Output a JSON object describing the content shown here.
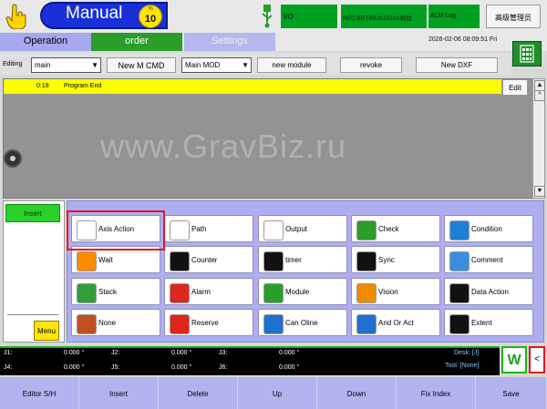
{
  "header": {
    "mode": "Manual",
    "speed_percent_label": "%",
    "speed_value": "10",
    "io_label": "I/O",
    "rec_label": "REC:BRTIRUS1510A机位",
    "alarm_log_label": "ALM Log",
    "user_label": "高级管理员"
  },
  "tabs": [
    {
      "label": "Operation"
    },
    {
      "label": "order"
    },
    {
      "label": "Settings"
    }
  ],
  "datetime": "2026-02-06  08:09:51 Fri",
  "editbar": {
    "editing_label": "Editing",
    "program_value": "main",
    "new_cmd_label": "New M CMD",
    "module_value": "Main MOD",
    "new_module_label": "new module",
    "revoke_label": "revoke",
    "new_dxf_label": "New DXF"
  },
  "program": {
    "line_number": "0:18",
    "line_text": "Program End",
    "edit_label": "Edit",
    "watermark": "www.GravBiz.ru"
  },
  "left_panel": {
    "insert_label": "Insert",
    "menu_label": "Menu"
  },
  "actions": [
    {
      "label": "Axis Action",
      "icon": "axis-action-icon",
      "color": "#ffffff"
    },
    {
      "label": "Path",
      "icon": "path-icon",
      "color": "#ffffff"
    },
    {
      "label": "Output",
      "icon": "output-icon",
      "color": "#ffffff"
    },
    {
      "label": "Check",
      "icon": "check-shield-icon",
      "color": "#2a9d2a"
    },
    {
      "label": "Condition",
      "icon": "condition-icon",
      "color": "#1e7fd9"
    },
    {
      "label": "Wait",
      "icon": "wait-pause-icon",
      "color": "#ff8a00"
    },
    {
      "label": "Counter",
      "icon": "counter-icon",
      "color": "#111111"
    },
    {
      "label": "timer",
      "icon": "timer-icon",
      "color": "#111111"
    },
    {
      "label": "Sync",
      "icon": "sync-arrows-icon",
      "color": "#111111"
    },
    {
      "label": "Comment",
      "icon": "comment-bubble-icon",
      "color": "#3a8ee0"
    },
    {
      "label": "Stack",
      "icon": "stack-cubes-icon",
      "color": "#2f9e3a"
    },
    {
      "label": "Alarm",
      "icon": "alarm-hand-icon",
      "color": "#e0251b"
    },
    {
      "label": "Module",
      "icon": "module-icon",
      "color": "#2a9d2a"
    },
    {
      "label": "Vision",
      "icon": "vision-camera-icon",
      "color": "#f08a00"
    },
    {
      "label": "Data Action",
      "icon": "data-action-icon",
      "color": "#111111"
    },
    {
      "label": "None",
      "icon": "none-brush-icon",
      "color": "#c05020"
    },
    {
      "label": "Reserve",
      "icon": "reserve-icon",
      "color": "#e0251b"
    },
    {
      "label": "Can Oline",
      "icon": "can-online-icon",
      "color": "#2070d0"
    },
    {
      "label": "And Or Act",
      "icon": "and-or-icon",
      "color": "#2070d0"
    },
    {
      "label": "Extent",
      "icon": "extent-icon",
      "color": "#111111"
    }
  ],
  "status": {
    "joints": [
      {
        "name": "J1:",
        "value": "0.000 °"
      },
      {
        "name": "J2:",
        "value": "0.000 °"
      },
      {
        "name": "J3:",
        "value": "0.000 °"
      },
      {
        "name": "J4:",
        "value": "0.000 °"
      },
      {
        "name": "J5:",
        "value": "0.000 °"
      },
      {
        "name": "J6:",
        "value": "0.000 °"
      }
    ],
    "desk": "Desk: [J]",
    "tool": "Tool: [None]",
    "w_label": "W",
    "back_label": "<"
  },
  "bottom_bar": [
    {
      "label": "Editor S/H"
    },
    {
      "label": "Insert"
    },
    {
      "label": "Delete"
    },
    {
      "label": "Up"
    },
    {
      "label": "Down"
    },
    {
      "label": "Fix Index"
    },
    {
      "label": "Save"
    }
  ],
  "colors": {
    "accent_green": "#2a9d2a",
    "mode_blue": "#1a2fd8",
    "highlight_red": "#e8141a",
    "bottom_bar": "#b3b3ef"
  }
}
